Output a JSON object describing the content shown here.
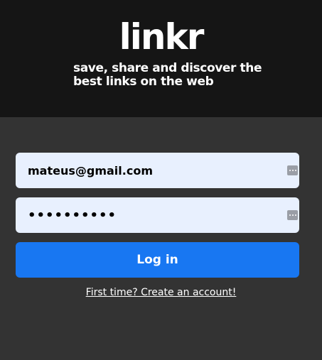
{
  "header": {
    "logo": "linkr",
    "tagline_line1": "save, share and discover the",
    "tagline_line2": "best links on the web"
  },
  "form": {
    "email_value": "mateus@gmail.com",
    "password_value": "••••••••••",
    "login_label": "Log in",
    "signup_link": "First time? Create an account!"
  },
  "colors": {
    "header_bg": "#151515",
    "page_bg": "#333333",
    "field_bg": "#e8f0fe",
    "button_bg": "#1877f2",
    "text": "#ffffff"
  },
  "icons": {
    "autofill": "key-autofill-icon"
  }
}
